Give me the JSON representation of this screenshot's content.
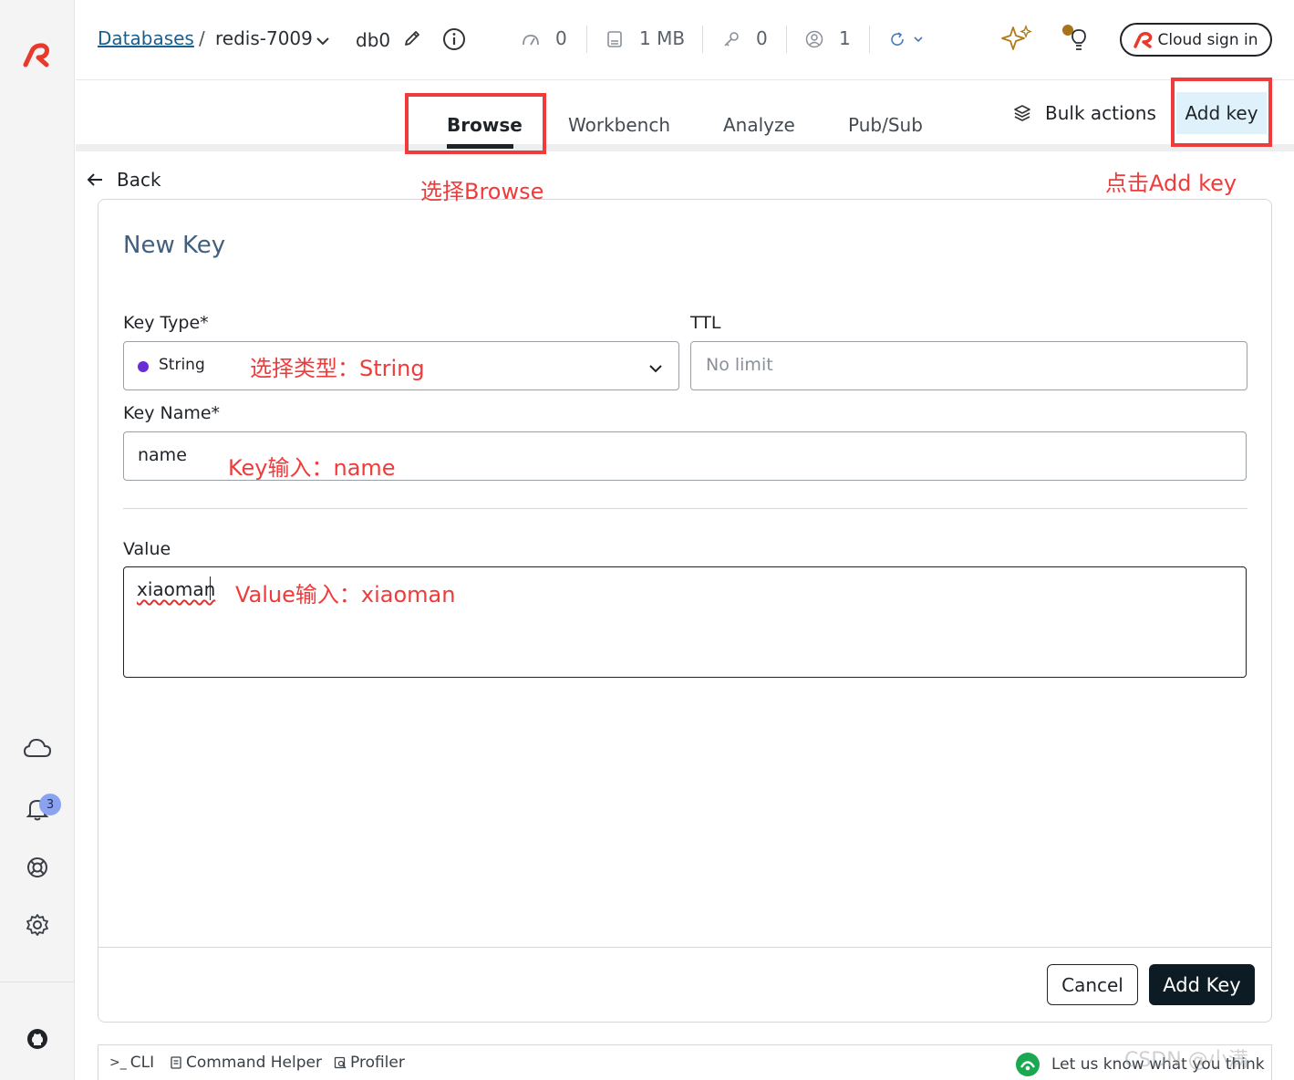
{
  "header": {
    "breadcrumb_databases": "Databases",
    "breadcrumb_sep": "/",
    "db_name": "redis-7009",
    "db_index": "db0",
    "stats": {
      "cpu": "0",
      "memory": "1 MB",
      "keys": "0",
      "clients": "1"
    },
    "cloud_sign_in": "Cloud sign in"
  },
  "tabs": [
    "Browse",
    "Workbench",
    "Analyze",
    "Pub/Sub"
  ],
  "actions": {
    "bulk_actions": "Bulk actions",
    "add_key": "Add key"
  },
  "annotations": {
    "browse": "选择Browse",
    "add_key": "点击Add key",
    "type": "选择类型：String",
    "key": "Key输入：name",
    "value": "Value输入：xiaoman"
  },
  "back_label": "Back",
  "form": {
    "title": "New Key",
    "key_type_label": "Key Type*",
    "key_type_value": "String",
    "ttl_label": "TTL",
    "ttl_placeholder": "No limit",
    "key_name_label": "Key Name*",
    "key_name_value": "name",
    "value_label": "Value",
    "value_text": "xiaoman",
    "cancel": "Cancel",
    "submit": "Add Key"
  },
  "notifications_count": "3",
  "bottom_bar": {
    "cli": "CLI",
    "command_helper": "Command Helper",
    "profiler": "Profiler",
    "feedback": "Let us know what you think",
    "watermark": "CSDN @小满"
  },
  "colors": {
    "annotation_red": "#ef3b3b",
    "brand_red": "#e8392d",
    "string_dot": "#6b2bd6",
    "add_key_bg": "#dff2fb",
    "primary_button": "#0d1b24",
    "badge": "#8ba2f0"
  }
}
